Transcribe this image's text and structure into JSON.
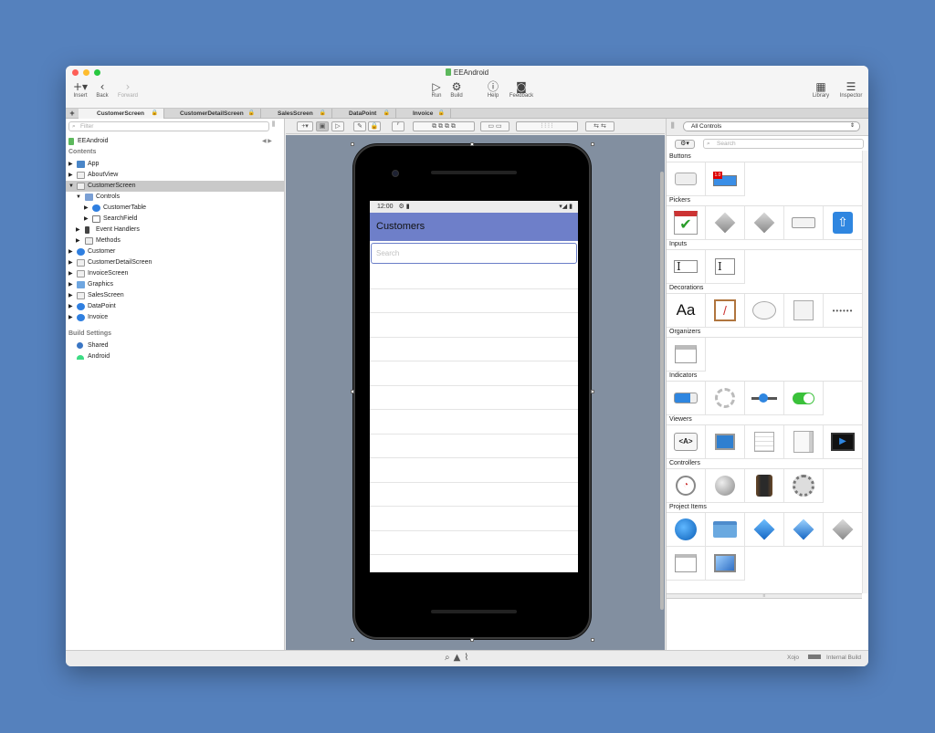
{
  "window": {
    "title": "EEAndroid"
  },
  "toolbar": {
    "insert": "Insert",
    "back": "Back",
    "forward": "Forward",
    "run": "Run",
    "build": "Build",
    "help": "Help",
    "feedback": "Feedback",
    "library": "Library",
    "inspector": "Inspector"
  },
  "tabs": [
    "CustomerScreen",
    "CustomerDetailScreen",
    "SalesScreen",
    "DataPoint",
    "Invoice"
  ],
  "navigator": {
    "filter_placeholder": "Filter",
    "project": "EEAndroid",
    "contents_header": "Contents",
    "items": {
      "app": "App",
      "aboutview": "AboutView",
      "customerscreen": "CustomerScreen",
      "controls": "Controls",
      "customertable": "CustomerTable",
      "searchfield": "SearchField",
      "eventhandlers": "Event Handlers",
      "methods": "Methods",
      "customer": "Customer",
      "customerdetail": "CustomerDetailScreen",
      "invoicescreen": "InvoiceScreen",
      "graphics": "Graphics",
      "salesscreen": "SalesScreen",
      "datapoint": "DataPoint",
      "invoice": "Invoice"
    },
    "build_header": "Build Settings",
    "build": {
      "shared": "Shared",
      "android": "Android"
    }
  },
  "phone": {
    "time": "12:00",
    "app_title": "Customers",
    "search_placeholder": "Search"
  },
  "library": {
    "filter": "All Controls",
    "search_placeholder": "Search",
    "categories": {
      "buttons": "Buttons",
      "pickers": "Pickers",
      "inputs": "Inputs",
      "decorations": "Decorations",
      "organizers": "Organizers",
      "indicators": "Indicators",
      "viewers": "Viewers",
      "controllers": "Controllers",
      "projectitems": "Project Items"
    },
    "label_aa": "Aa",
    "label_dots": "••••••",
    "label_html": "<A>",
    "badge": "1.0"
  },
  "statusbar": {
    "app": "Xojo",
    "build": "Internal Build"
  },
  "colors": {
    "accent": "#6e7fc9",
    "desktop": "#5581bd"
  }
}
